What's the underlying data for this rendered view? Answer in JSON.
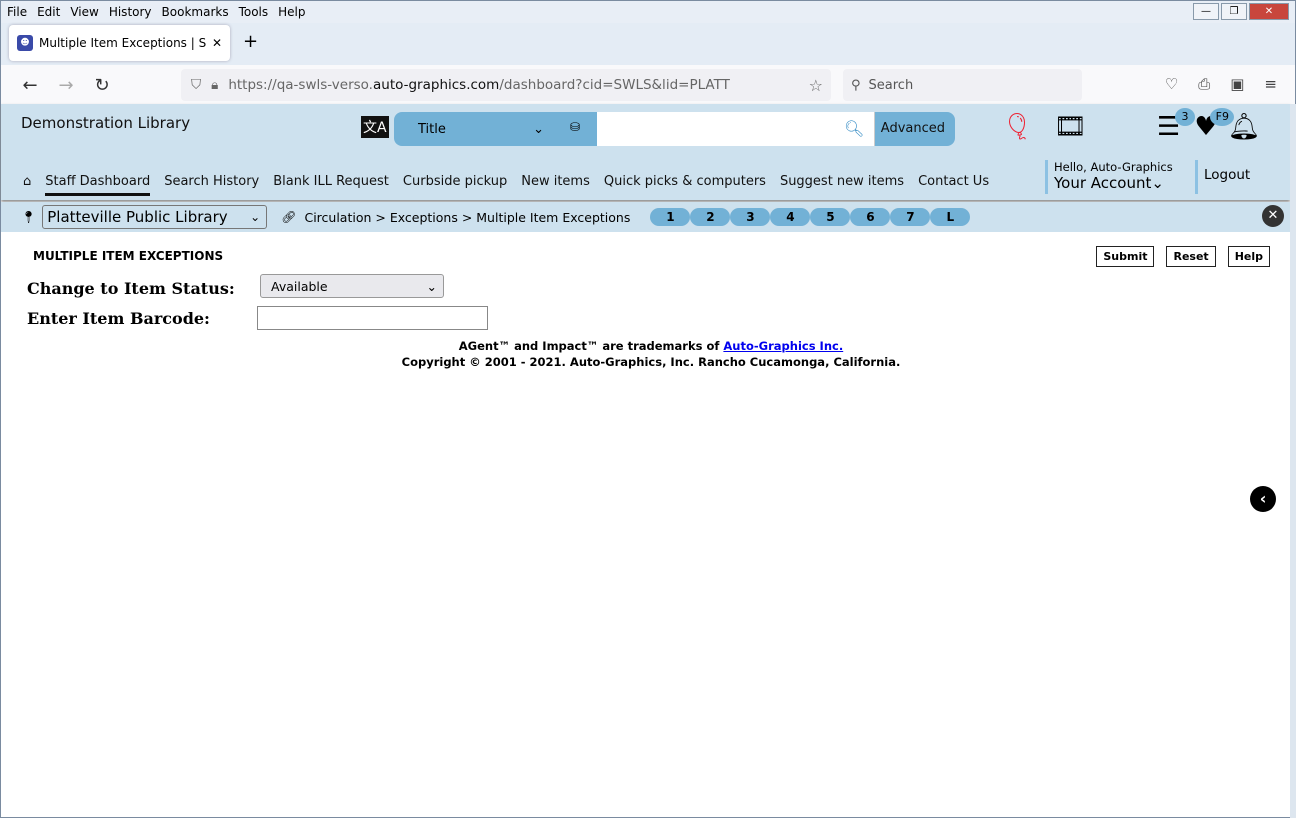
{
  "browser": {
    "menu": [
      "File",
      "Edit",
      "View",
      "History",
      "Bookmarks",
      "Tools",
      "Help"
    ],
    "tab_title": "Multiple Item Exceptions | SWLS",
    "url_prefix": "https://qa-swls-verso.",
    "url_domain": "auto-graphics.com",
    "url_suffix": "/dashboard?cid=SWLS&lid=PLATT",
    "search_placeholder": "Search"
  },
  "app": {
    "library_name": "Demonstration Library",
    "search_type": "Title",
    "search_value": "",
    "advanced_label": "Advanced",
    "list_badge": "3",
    "fav_badge": "F9",
    "nav": [
      "Staff Dashboard",
      "Search History",
      "Blank ILL Request",
      "Curbside pickup",
      "New items",
      "Quick picks & computers",
      "Suggest new items",
      "Contact Us"
    ],
    "greeting": "Hello, Auto-Graphics",
    "account_label": "Your Account",
    "logout_label": "Logout",
    "location": "Platteville Public Library",
    "breadcrumb": "Circulation > Exceptions > Multiple Item Exceptions",
    "pills": [
      "1",
      "2",
      "3",
      "4",
      "5",
      "6",
      "7",
      "L"
    ]
  },
  "page": {
    "title": "MULTIPLE ITEM EXCEPTIONS",
    "submit": "Submit",
    "reset": "Reset",
    "help": "Help",
    "status_label": "Change to Item Status:",
    "status_value": "Available",
    "barcode_label": "Enter Item Barcode:",
    "barcode_value": "",
    "trademark_text": "AGent™ and Impact™ are trademarks of ",
    "trademark_link": "Auto-Graphics Inc.",
    "copyright": "Copyright © 2001 - 2021. Auto-Graphics, Inc. Rancho Cucamonga, California."
  },
  "colors": {
    "header_bg": "#cde1ee",
    "accent": "#72b1d6"
  }
}
